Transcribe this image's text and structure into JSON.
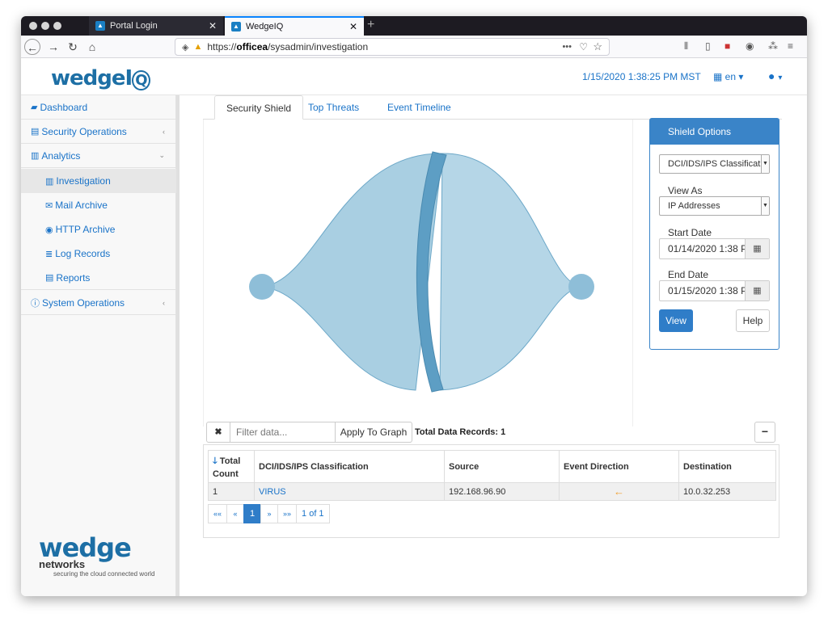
{
  "browser": {
    "tabs": [
      {
        "title": "Portal Login",
        "close": "✕"
      },
      {
        "title": "WedgeIQ",
        "close": "✕"
      }
    ],
    "new_tab": "+",
    "url_prefix": "https://",
    "url_host": "officea",
    "url_path": "/sysadmin/investigation",
    "more": "•••"
  },
  "header": {
    "logo": "wedge",
    "logo_q": "Q",
    "datetime": "1/15/2020 1:38:25 PM MST",
    "lang": "en ▾",
    "user": "▾"
  },
  "sidebar": {
    "items": [
      {
        "icon": "▰",
        "label": "Dashboard"
      },
      {
        "icon": "▤",
        "label": "Security Operations",
        "chevron": "‹"
      },
      {
        "icon": "▥",
        "label": "Analytics",
        "chevron": "⌄"
      },
      {
        "icon": "▥",
        "label": "Investigation"
      },
      {
        "icon": "✉",
        "label": "Mail Archive"
      },
      {
        "icon": "◉",
        "label": "HTTP Archive"
      },
      {
        "icon": "≣",
        "label": "Log Records"
      },
      {
        "icon": "▤",
        "label": "Reports"
      },
      {
        "icon": "ⓘ",
        "label": "System Operations",
        "chevron": "‹"
      }
    ],
    "footer_logo": "wedge",
    "footer_net": "networks",
    "footer_tag": "securing the cloud connected world"
  },
  "main": {
    "tabs": [
      "Security Shield",
      "Top Threats",
      "Event Timeline"
    ]
  },
  "shield_options": {
    "title": "Shield Options",
    "classification": "DCI/IDS/IPS Classification",
    "view_as_label": "View As",
    "view_as": "IP Addresses",
    "start_label": "Start Date",
    "start_date": "01/14/2020 1:38 P",
    "end_label": "End Date",
    "end_date": "01/15/2020 1:38 P",
    "view_btn": "View",
    "help_btn": "Help"
  },
  "filter": {
    "clear": "✖",
    "placeholder": "Filter data...",
    "apply": "Apply To Graph",
    "total": "Total Data Records: 1",
    "collapse": "−"
  },
  "table": {
    "headers": [
      "Total Count",
      "DCI/IDS/IPS Classification",
      "Source",
      "Event Direction",
      "Destination"
    ],
    "sort_icon": "🡓",
    "rows": [
      {
        "count": "1",
        "classification": "VIRUS",
        "source": "192.168.96.90",
        "direction": "←",
        "destination": "10.0.32.253"
      }
    ]
  },
  "pager": {
    "first": "««",
    "prev": "«",
    "page": "1",
    "next": "»",
    "last": "»»",
    "info": "1 of 1"
  },
  "colors": {
    "accent": "#2f7dc8",
    "flow_fill": "#a9cfe2",
    "flow_band": "#5d9ec4",
    "arrow": "#f0a030"
  }
}
